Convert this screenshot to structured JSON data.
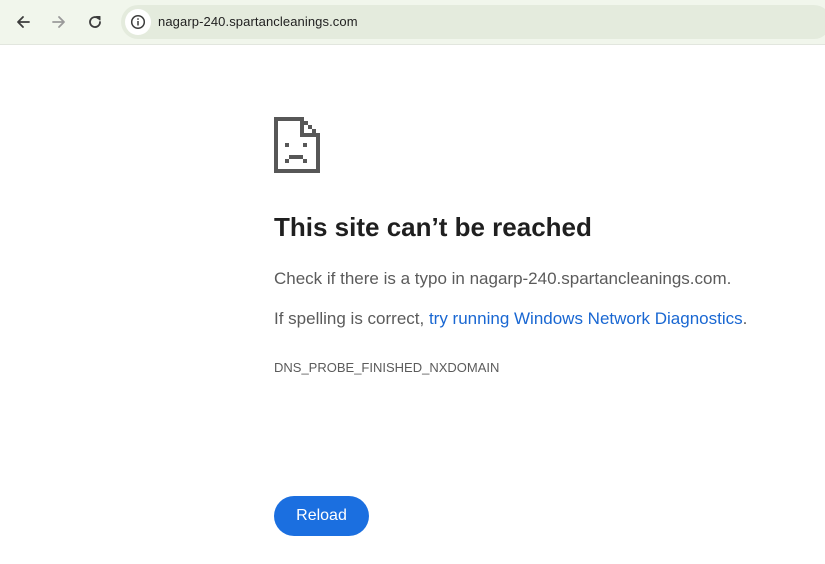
{
  "browser": {
    "url": "nagarp-240.spartancleanings.com",
    "icons": {
      "back": "arrow-left-icon",
      "forward": "arrow-right-icon",
      "reload": "reload-icon",
      "site_info": "info-circle-icon"
    }
  },
  "error_page": {
    "icon": "sad-page-icon",
    "title": "This site can’t be reached",
    "line1": "Check if there is a typo in nagarp-240.spartancleanings.com.",
    "line2_prefix": "If spelling is correct, ",
    "line2_link": "try running Windows Network Diagnostics",
    "line2_suffix": ".",
    "error_code": "DNS_PROBE_FINISHED_NXDOMAIN",
    "reload_label": "Reload"
  },
  "colors": {
    "toolbar_bg": "#f1f6ec",
    "omnibox_bg": "#e4ebdd",
    "link": "#1967d2",
    "button": "#1b6fe0"
  }
}
